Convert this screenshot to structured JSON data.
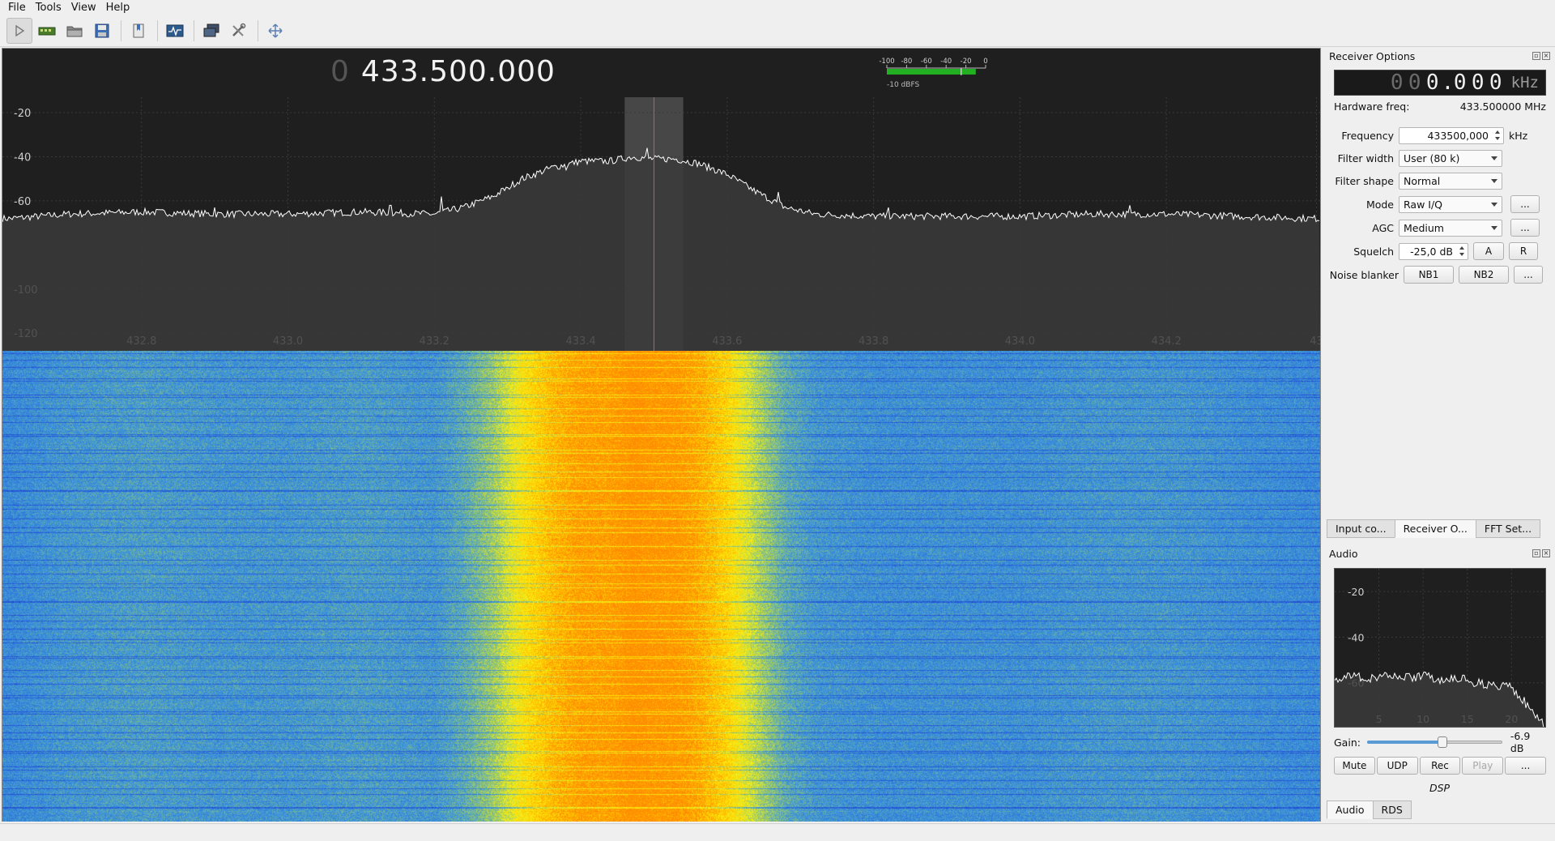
{
  "menu": [
    "File",
    "Tools",
    "View",
    "Help"
  ],
  "toolbar": {
    "icons": [
      "play-icon",
      "hardware-icon",
      "open-icon",
      "save-icon",
      "bookmark-icon",
      "network-icon",
      "remote-icon",
      "tools-icon",
      "fullscreen-icon"
    ]
  },
  "main": {
    "freq_dim": "0",
    "freq_value": "433.500.000",
    "meter_ticks": [
      "-100",
      "-80",
      "-60",
      "-40",
      "-20",
      "0"
    ],
    "meter_label": "-10 dBFS",
    "meter_level_dbfs": -10
  },
  "chart_data": [
    {
      "type": "line",
      "title": "",
      "xlabel": "",
      "ylabel": "",
      "x_ticks": [
        "432.8",
        "433.0",
        "433.2",
        "433.4",
        "433.6",
        "433.8",
        "434.0",
        "434.2",
        "43"
      ],
      "y_ticks": [
        "-20",
        "-40",
        "-60",
        "-100",
        "-120"
      ],
      "xlim": [
        432.61,
        434.41
      ],
      "ylim": [
        -128,
        -13
      ],
      "grid": true,
      "center_freq": 433.5,
      "filter_band": [
        433.46,
        433.54
      ],
      "series": [
        {
          "x": [
            432.62,
            432.7,
            432.8,
            432.9,
            433.0,
            433.1,
            433.2,
            433.24,
            433.28,
            433.32,
            433.36,
            433.4,
            433.44,
            433.47,
            433.5,
            433.53,
            433.56,
            433.6,
            433.64,
            433.68,
            433.72,
            433.8,
            433.9,
            434.0,
            434.1,
            434.2,
            434.3,
            434.4
          ],
          "y": [
            -68,
            -66,
            -65,
            -66,
            -66,
            -65,
            -66,
            -63,
            -58,
            -50,
            -45,
            -42,
            -42,
            -40,
            -41,
            -41,
            -43,
            -48,
            -56,
            -63,
            -66,
            -67,
            -67,
            -67,
            -66,
            -66,
            -67,
            -68
          ]
        }
      ]
    },
    {
      "type": "line",
      "title": "",
      "xlabel": "",
      "ylabel": "",
      "x_ticks": [
        "5",
        "10",
        "15",
        "20"
      ],
      "y_ticks": [
        "-20",
        "-40",
        "-60"
      ],
      "xlim": [
        0,
        24
      ],
      "ylim": [
        -80,
        -10
      ],
      "series": [
        {
          "x": [
            0,
            2,
            4,
            6,
            8,
            10,
            12,
            14,
            16,
            18,
            20,
            21,
            22,
            23,
            24
          ],
          "y": [
            -59,
            -57,
            -58,
            -56,
            -58,
            -57,
            -59,
            -58,
            -60,
            -61,
            -62,
            -66,
            -71,
            -76,
            -80
          ]
        }
      ]
    }
  ],
  "receiver": {
    "title": "Receiver Options",
    "lcd_digits": [
      "0",
      "0",
      "0",
      "0",
      "0",
      "0"
    ],
    "lcd_unit": "kHz",
    "hw_label": "Hardware freq:",
    "hw_value": "433.500000 MHz",
    "frequency_label": "Frequency",
    "frequency_value": "433500,000",
    "frequency_unit": "kHz",
    "filter_width_label": "Filter width",
    "filter_width_value": "User (80 k)",
    "filter_shape_label": "Filter shape",
    "filter_shape_value": "Normal",
    "mode_label": "Mode",
    "mode_value": "Raw I/Q",
    "agc_label": "AGC",
    "agc_value": "Medium",
    "squelch_label": "Squelch",
    "squelch_value": "-25,0 dB",
    "squelch_a": "A",
    "squelch_r": "R",
    "noise_label": "Noise blanker",
    "nb1": "NB1",
    "nb2": "NB2",
    "more": "..."
  },
  "tabs_top": [
    "Input co...",
    "Receiver O...",
    "FFT Set..."
  ],
  "audio": {
    "title": "Audio",
    "gain_label": "Gain:",
    "gain_value": "-6.9 dB",
    "gain_fraction": 0.55,
    "buttons": [
      "Mute",
      "UDP",
      "Rec",
      "Play",
      "..."
    ],
    "dsp": "DSP"
  },
  "tabs_bottom": [
    "Audio",
    "RDS"
  ],
  "colors": {
    "plot_bg": "#1f1f1f",
    "trace": "#ffffff",
    "center_line": "#e05050",
    "meter_green": "#22b022",
    "waterfall_low": "#2e5fd6",
    "waterfall_high": "#ff9a00"
  }
}
